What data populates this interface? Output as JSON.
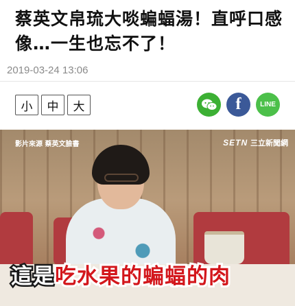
{
  "article": {
    "headline": "蔡英文帛琉大啖蝙蝠湯！直呼口感像…一生也忘不了！",
    "timestamp": "2019-03-24 13:06"
  },
  "font_size_controls": {
    "small": "小",
    "medium": "中",
    "large": "大"
  },
  "share": {
    "wechat_icon": "wechat-icon",
    "facebook_label": "f",
    "line_label": "LINE",
    "colors": {
      "wechat": "#3cb034",
      "facebook": "#3b5998",
      "line": "#4cc04a"
    }
  },
  "video": {
    "source_label": "影片來源 蔡英文臉書",
    "brand_logo": "SETN",
    "brand_name": "三立新聞網",
    "subtitle_white": "這是",
    "subtitle_red": "吃水果的蝙蝠的肉"
  }
}
